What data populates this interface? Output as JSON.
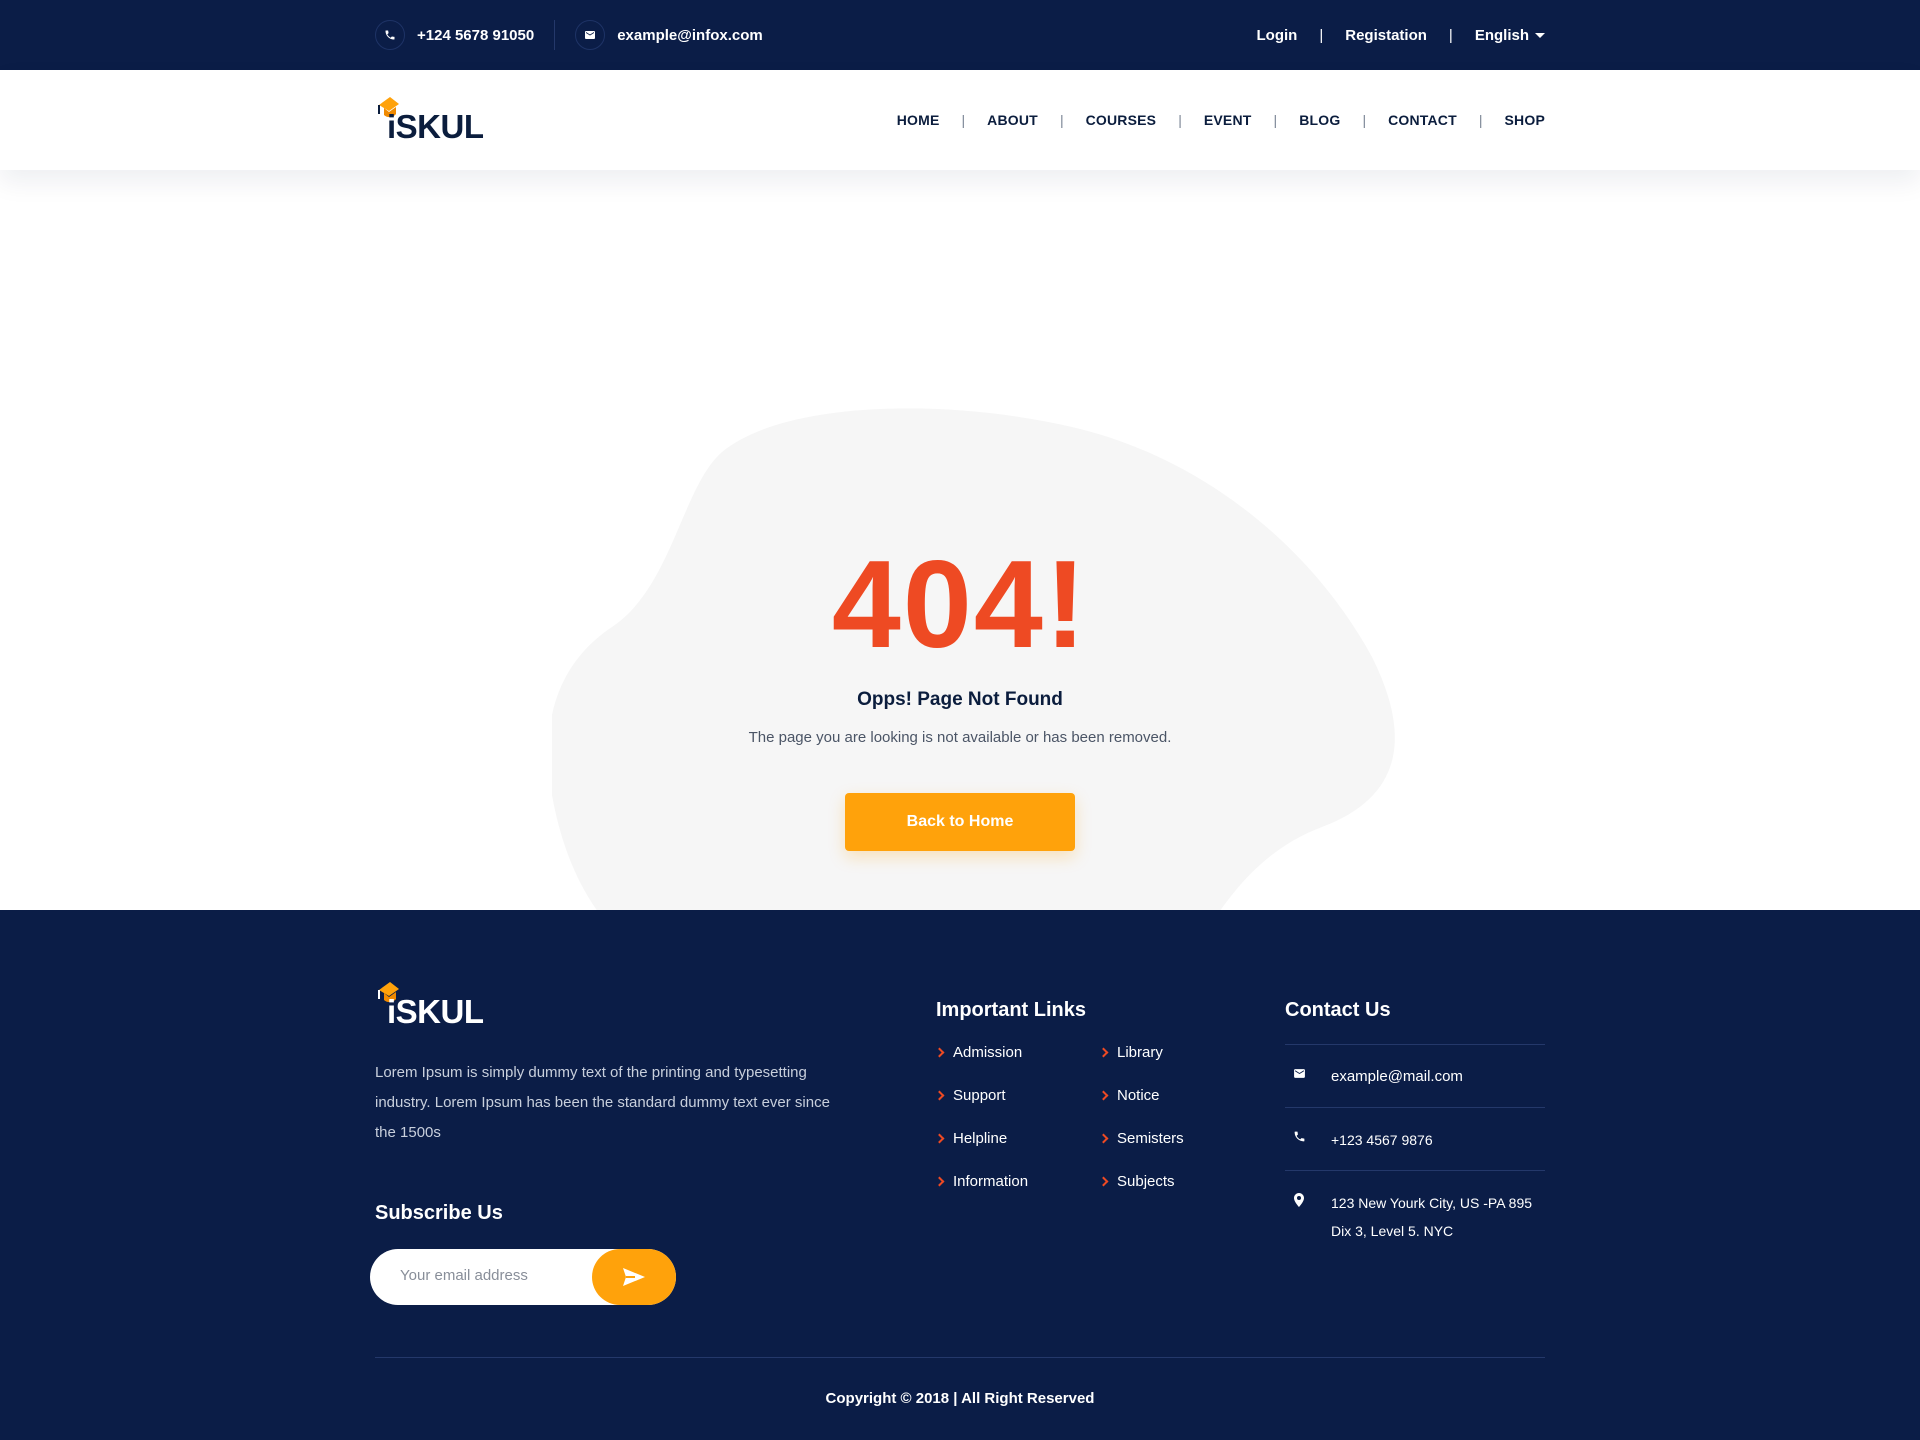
{
  "topbar": {
    "phone": "+124 5678 91050",
    "email": "example@infox.com",
    "login": "Login",
    "register": "Registation",
    "language": "English",
    "separator": "|"
  },
  "brand": {
    "logo_text": "iSKUL",
    "logo_color": "#ffa20b"
  },
  "nav": {
    "items": [
      "HOME",
      "ABOUT",
      "COURSES",
      "EVENT",
      "BLOG",
      "CONTACT",
      "SHOP"
    ],
    "separator": "|"
  },
  "error": {
    "code": "404!",
    "title": "Opps! Page Not Found",
    "text": "The page you are looking is not available or has been removed.",
    "button": "Back to Home"
  },
  "footer": {
    "about": "Lorem Ipsum is simply dummy text of the printing and typesetting industry. Lorem Ipsum has been the standard dummy text ever since the 1500s",
    "subscribe_heading": "Subscribe Us",
    "subscribe_placeholder": "Your email address",
    "links_heading": "Important Links",
    "links": [
      "Admission",
      "Library",
      "Support",
      "Notice",
      "Helpline",
      "Semisters",
      "Information",
      "Subjects"
    ],
    "contact_heading": "Contact Us",
    "contact_email": "example@mail.com",
    "contact_phone": "+123 4567 9876",
    "contact_address": "123 New Yourk City, US -PA 895 Dix 3, Level 5. NYC",
    "copyright": "Copyright © 2018 |  All Right Reserved"
  },
  "colors": {
    "navy": "#0b1d47",
    "accent_orange": "#ffa20b",
    "error_red": "#ee4a23"
  }
}
